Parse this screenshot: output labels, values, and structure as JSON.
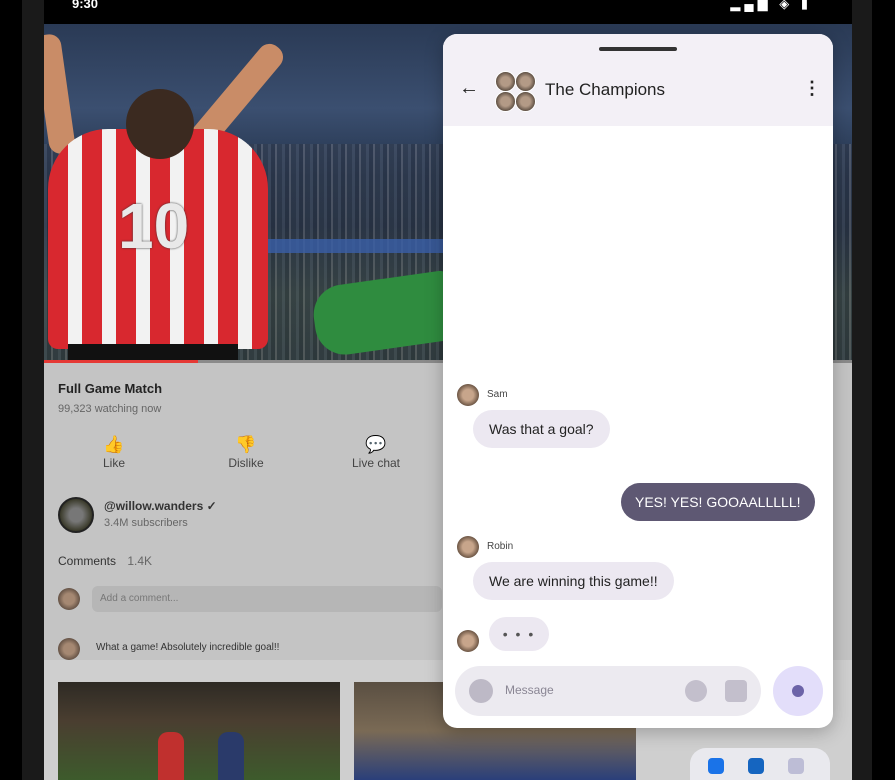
{
  "status": {
    "time": "9:30",
    "icons": "▂▄▆ ◈ ▮"
  },
  "video": {
    "jersey_number": "10",
    "progress_fraction": 0.19
  },
  "details": {
    "title": "Full Game Match",
    "watching": "99,323 watching now",
    "actions": [
      {
        "icon": "thumb-up-icon",
        "glyph": "👍",
        "label": "Like"
      },
      {
        "icon": "thumb-down-icon",
        "glyph": "👎",
        "label": "Dislike"
      },
      {
        "icon": "live-chat-icon",
        "glyph": "💬",
        "label": "Live chat"
      }
    ],
    "channel": {
      "name": "@willow.wanders ✓",
      "subscribers": "3.4M subscribers"
    },
    "comments": {
      "label": "Comments",
      "count": "1.4K",
      "add_placeholder": "Add a comment...",
      "top_comment": "What a game! Absolutely incredible goal!!"
    }
  },
  "chat": {
    "back_glyph": "←",
    "title": "The Champions",
    "menu_glyph": "⋮",
    "messages": [
      {
        "sender": "Sam",
        "text": "Was that a goal?",
        "direction": "in"
      },
      {
        "sender": "",
        "text": "YES! YES! GOOAALLLLL!",
        "direction": "out"
      },
      {
        "sender": "Robin",
        "text": "We are winning this game!!",
        "direction": "in"
      }
    ],
    "typing": "• • •",
    "compose_placeholder": "Message"
  },
  "colors": {
    "accent": "#5e5873",
    "bubble_in": "#ece8f1",
    "progress": "#e53935"
  }
}
